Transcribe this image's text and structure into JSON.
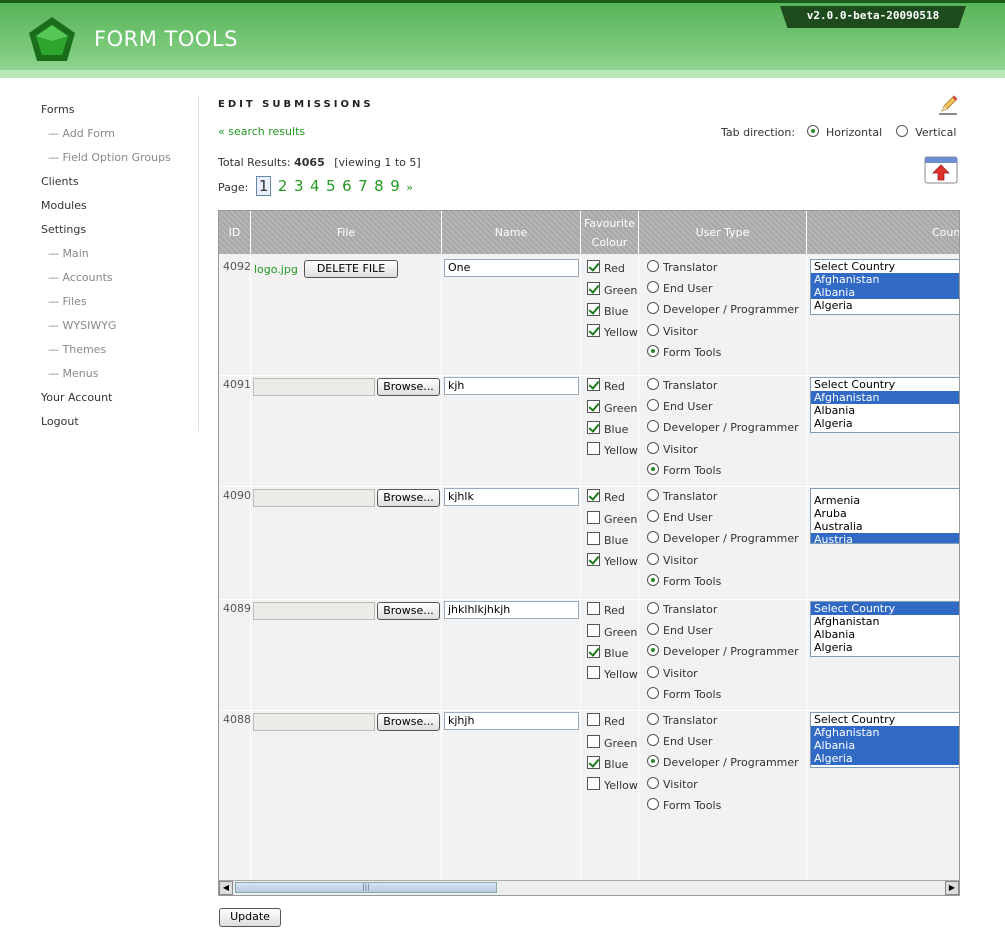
{
  "header": {
    "title": "FORM TOOLS",
    "version": "v2.0.0-beta-20090518"
  },
  "sidebar": {
    "items": [
      {
        "label": "Forms",
        "sub": false
      },
      {
        "label": "— Add Form",
        "sub": true
      },
      {
        "label": "— Field Option Groups",
        "sub": true
      },
      {
        "label": "Clients",
        "sub": false
      },
      {
        "label": "Modules",
        "sub": false
      },
      {
        "label": "Settings",
        "sub": false
      },
      {
        "label": "— Main",
        "sub": true
      },
      {
        "label": "— Accounts",
        "sub": true
      },
      {
        "label": "— Files",
        "sub": true
      },
      {
        "label": "— WYSIWYG",
        "sub": true
      },
      {
        "label": "— Themes",
        "sub": true
      },
      {
        "label": "— Menus",
        "sub": true
      },
      {
        "label": "Your Account",
        "sub": false
      },
      {
        "label": "Logout",
        "sub": false
      }
    ]
  },
  "main": {
    "title": "EDIT SUBMISSIONS",
    "back_link": "« search results",
    "tab_direction": {
      "label": "Tab direction:",
      "options": [
        "Horizontal",
        "Vertical"
      ],
      "selected": "Horizontal"
    },
    "total": {
      "prefix": "Total Results:",
      "count": "4065",
      "viewing": "[viewing 1 to 5]"
    },
    "pager": {
      "label": "Page:",
      "pages": [
        "1",
        "2",
        "3",
        "4",
        "5",
        "6",
        "7",
        "8",
        "9"
      ],
      "current": "1",
      "next": "»"
    },
    "update_label": "Update"
  },
  "grid": {
    "columns": [
      "ID",
      "File",
      "Name",
      "Favourite\nColour",
      "User Type",
      "Country"
    ],
    "colour_options": [
      "Red",
      "Green",
      "Blue",
      "Yellow"
    ],
    "user_types": [
      "Translator",
      "End User",
      "Developer / Programmer",
      "Visitor",
      "Form Tools"
    ],
    "browse_label": "Browse...",
    "delete_label": "DELETE FILE",
    "rows": [
      {
        "id": "4092",
        "file": "logo.jpg",
        "name": "One",
        "colours": [
          true,
          true,
          true,
          true
        ],
        "user_type": 4,
        "country_options": [
          "Select Country",
          "Afghanistan",
          "Albania",
          "Algeria"
        ],
        "country_selected": [
          false,
          true,
          true,
          false
        ],
        "country_cut_top": false
      },
      {
        "id": "4091",
        "file": "",
        "name": "kjh",
        "colours": [
          true,
          true,
          true,
          false
        ],
        "user_type": 4,
        "country_options": [
          "Select Country",
          "Afghanistan",
          "Albania",
          "Algeria"
        ],
        "country_selected": [
          false,
          true,
          false,
          false
        ],
        "country_cut_top": false
      },
      {
        "id": "4090",
        "file": "",
        "name": "kjhlk",
        "colours": [
          true,
          false,
          false,
          true
        ],
        "user_type": 4,
        "country_options": [
          "Armenia",
          "Aruba",
          "Australia",
          "Austria"
        ],
        "country_selected": [
          false,
          false,
          false,
          true
        ],
        "country_cut_top": true
      },
      {
        "id": "4089",
        "file": "",
        "name": "jhklhlkjhkjh",
        "colours": [
          false,
          false,
          true,
          false
        ],
        "user_type": 2,
        "country_options": [
          "Select Country",
          "Afghanistan",
          "Albania",
          "Algeria"
        ],
        "country_selected": [
          true,
          false,
          false,
          false
        ],
        "country_cut_top": false
      },
      {
        "id": "4088",
        "file": "",
        "name": "kjhjh",
        "colours": [
          false,
          false,
          true,
          false
        ],
        "user_type": 2,
        "country_options": [
          "Select Country",
          "Afghanistan",
          "Albania",
          "Algeria"
        ],
        "country_selected": [
          false,
          true,
          true,
          true
        ],
        "country_cut_top": false
      }
    ]
  },
  "colors": {
    "brand_green": "#229922",
    "header_dark": "#1d4b1d",
    "selection": "#316ac5"
  }
}
